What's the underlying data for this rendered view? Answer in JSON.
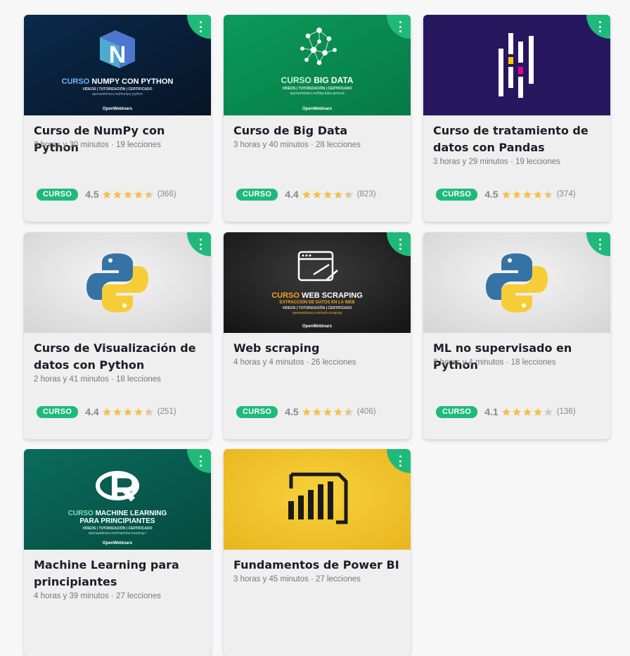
{
  "colors": {
    "accent": "#1fba7a",
    "star": "#f5c04a",
    "star_empty": "#cccccc"
  },
  "brand": {
    "owner": "OpenWebinars"
  },
  "courses": [
    {
      "title": "Curso de NumPy con Python",
      "duration": "3 horas y 30 minutos",
      "lessons": "19 lecciones",
      "badge": "CURSO",
      "rating": "4.5",
      "stars": 4.5,
      "reviews": "(366)",
      "thumb": {
        "line1_accent": "CURSO",
        "line1_rest": " NUMPY CON PYTHON",
        "line2": "VIDEOS | TUTORIZACIÓN | CERTIFICADO",
        "url": "openwebinars.net/numpy-python",
        "logo_letter": "N"
      }
    },
    {
      "title": "Curso de Big Data",
      "duration": "3 horas y 40 minutos",
      "lessons": "28 lecciones",
      "badge": "CURSO",
      "rating": "4.4",
      "stars": 4.4,
      "reviews": "(823)",
      "thumb": {
        "line1_accent": "CURSO",
        "line1_rest": " BIG DATA",
        "line2": "VIDEOS | TUTORIZACIÓN | CERTIFICADO",
        "url": "openwebinars.net/big-data-general"
      }
    },
    {
      "title": "Curso de tratamiento de datos con Pandas",
      "duration": "3 horas y 29 minutos",
      "lessons": "19 lecciones",
      "badge": "CURSO",
      "rating": "4.5",
      "stars": 4.5,
      "reviews": "(374)"
    },
    {
      "title": "Curso de Visualización de datos con Python",
      "duration": "2 horas y 41 minutos",
      "lessons": "18 lecciones",
      "badge": "CURSO",
      "rating": "4.4",
      "stars": 4.4,
      "reviews": "(251)"
    },
    {
      "title": "Web scraping",
      "duration": "4 horas y 4 minutos",
      "lessons": "26 lecciones",
      "badge": "CURSO",
      "rating": "4.5",
      "stars": 4.5,
      "reviews": "(406)",
      "thumb": {
        "line1_accent": "CURSO",
        "line1_rest": " WEB SCRAPING",
        "line2": "EXTRACCIÓN DE DATOS EN LA WEB",
        "line3": "VIDEOS | TUTORIZACIÓN | CERTIFICADO",
        "url": "openwebinars.net/web-scraping"
      }
    },
    {
      "title": "ML no supervisado en Python",
      "duration": "2 horas y 4 minutos",
      "lessons": "18 lecciones",
      "badge": "CURSO",
      "rating": "4.1",
      "stars": 4.1,
      "reviews": "(136)"
    },
    {
      "title": "Machine Learning para principiantes",
      "duration": "4 horas y 39 minutos",
      "lessons": "27 lecciones",
      "thumb": {
        "line1_accent": "CURSO",
        "line1_rest": " MACHINE LEARNING",
        "line2": "PARA PRINCIPIANTES",
        "line3": "VIDEOS | TUTORIZACIÓN | CERTIFICADO",
        "url": "openwebinars.net/machine-learning-r"
      }
    },
    {
      "title": "Fundamentos de Power BI",
      "duration": "3 horas y 45 minutos",
      "lessons": "27 lecciones"
    }
  ]
}
